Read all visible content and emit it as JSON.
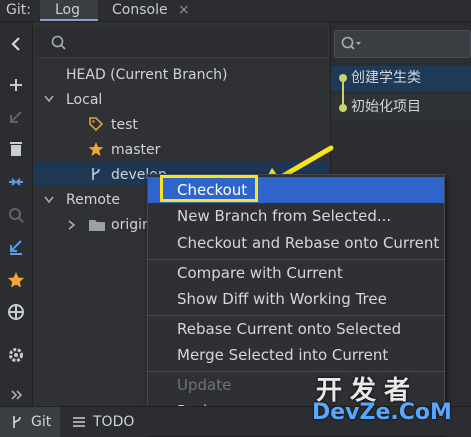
{
  "tabs": {
    "prefix": "Git:",
    "log": "Log",
    "console": "Console",
    "console_close": "×"
  },
  "tree": {
    "head": "HEAD (Current Branch)",
    "local": "Local",
    "test": "test",
    "master": "master",
    "develop": "develop",
    "remote": "Remote",
    "origin": "origin"
  },
  "commits": [
    {
      "message": "创建学生类"
    },
    {
      "message": "初始化项目"
    }
  ],
  "menu": {
    "checkout": "Checkout",
    "new_branch": "New Branch from Selected...",
    "checkout_rebase": "Checkout and Rebase onto Current",
    "compare": "Compare with Current",
    "show_diff": "Show Diff with Working Tree",
    "rebase": "Rebase Current onto Selected",
    "merge": "Merge Selected into Current",
    "update": "Update",
    "push": "Push..."
  },
  "bottom": {
    "git": "Git",
    "todo": "TODO"
  },
  "watermark": {
    "top": "开发者",
    "bottom": "DevZe.CoM"
  },
  "colors": {
    "accent": "#2f65ca",
    "highlight_annotation": "#f7e41c",
    "star": "#f0a732",
    "tag": "#d9a343",
    "graph": "#c9d36b"
  }
}
